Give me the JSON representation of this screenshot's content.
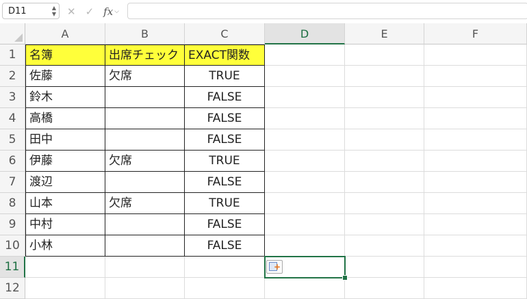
{
  "name_box": "D11",
  "formula": "",
  "fx_label": "fx",
  "columns": [
    "A",
    "B",
    "C",
    "D",
    "E",
    "F"
  ],
  "rows": [
    "1",
    "2",
    "3",
    "4",
    "5",
    "6",
    "7",
    "8",
    "9",
    "10",
    "11",
    "12"
  ],
  "header": {
    "a": "名簿",
    "b": "出席チェック",
    "c": "EXACT関数"
  },
  "data_rows": [
    {
      "name": "佐藤",
      "check": "欠席",
      "exact": "TRUE"
    },
    {
      "name": "鈴木",
      "check": "",
      "exact": "FALSE"
    },
    {
      "name": "高橋",
      "check": "",
      "exact": "FALSE"
    },
    {
      "name": "田中",
      "check": "",
      "exact": "FALSE"
    },
    {
      "name": "伊藤",
      "check": "欠席",
      "exact": "TRUE"
    },
    {
      "name": "渡辺",
      "check": "",
      "exact": "FALSE"
    },
    {
      "name": "山本",
      "check": "欠席",
      "exact": "TRUE"
    },
    {
      "name": "中村",
      "check": "",
      "exact": "FALSE"
    },
    {
      "name": "小林",
      "check": "",
      "exact": "FALSE"
    }
  ],
  "colors": {
    "header_fill": "#ffff3a",
    "selection": "#217346"
  },
  "icons": {
    "cancel": "cancel-x-icon",
    "confirm": "checkmark-icon",
    "paste_options": "paste-options-icon"
  }
}
